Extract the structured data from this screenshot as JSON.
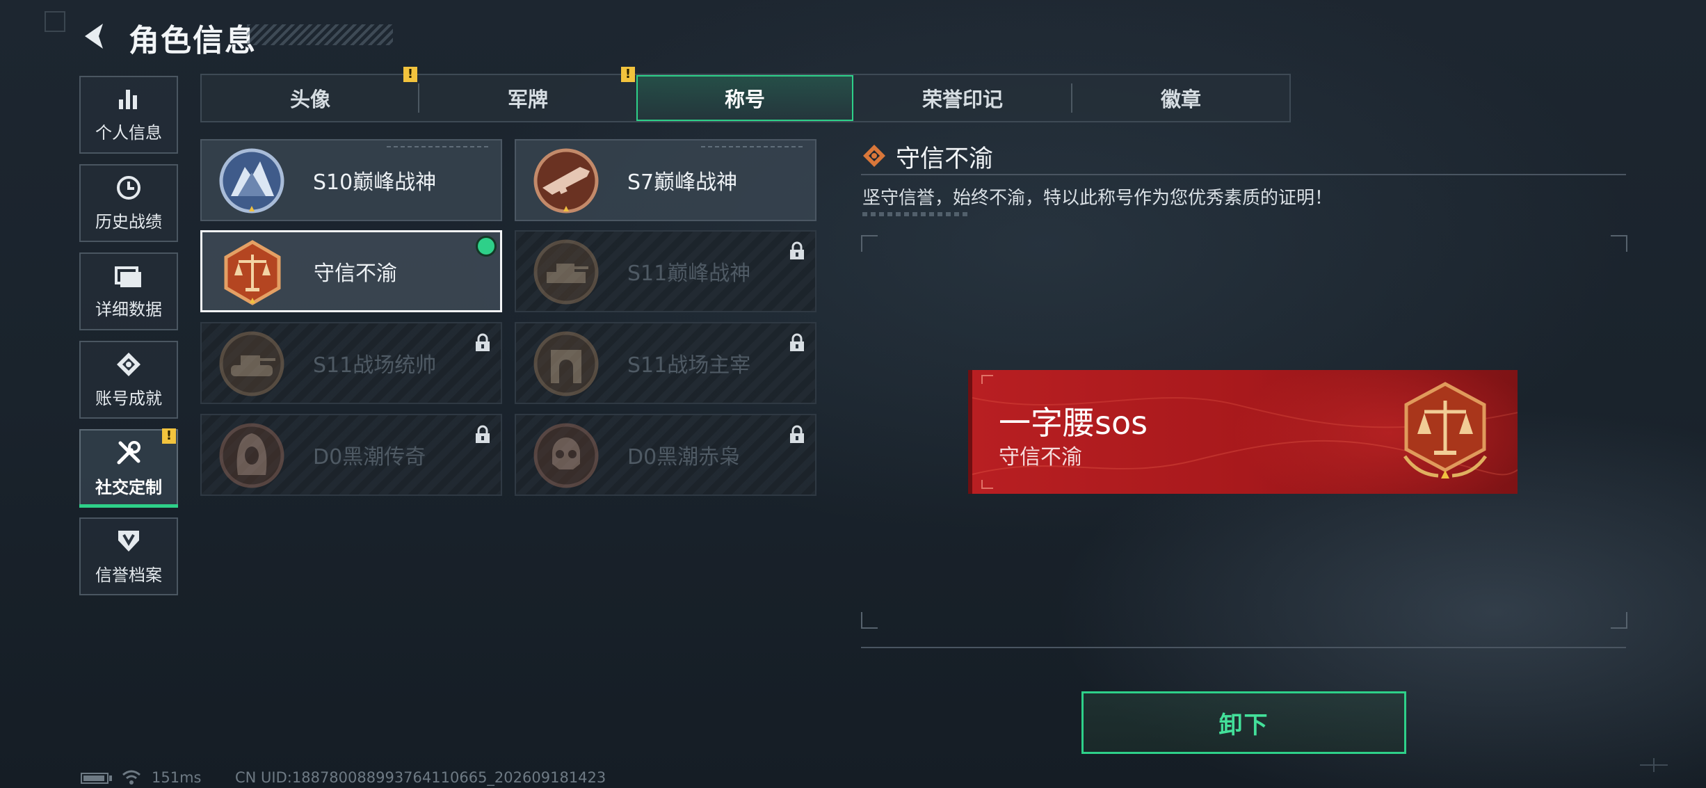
{
  "header": {
    "title": "角色信息"
  },
  "nav": [
    {
      "label": "个人信息",
      "icon": "bar-chart-icon"
    },
    {
      "label": "历史战绩",
      "icon": "clock-icon"
    },
    {
      "label": "详细数据",
      "icon": "folder-icon"
    },
    {
      "label": "账号成就",
      "icon": "achievement-icon"
    },
    {
      "label": "社交定制",
      "icon": "tools-icon",
      "active": true,
      "alert": "!"
    },
    {
      "label": "信誉档案",
      "icon": "credit-icon"
    }
  ],
  "tabs": [
    {
      "label": "头像",
      "alert": "!"
    },
    {
      "label": "军牌",
      "alert": "!"
    },
    {
      "label": "称号",
      "active": true
    },
    {
      "label": "荣誉印记"
    },
    {
      "label": "徽章"
    }
  ],
  "titles": [
    {
      "name": "S10巅峰战神",
      "state": "unlocked",
      "medal": "mountain-medal-icon"
    },
    {
      "name": "S7巅峰战神",
      "state": "unlocked",
      "medal": "weapon-medal-icon"
    },
    {
      "name": "守信不渝",
      "state": "equipped",
      "medal": "scales-medal-icon"
    },
    {
      "name": "S11巅峰战神",
      "state": "locked",
      "medal": "tank-medal-icon"
    },
    {
      "name": "S11战场统帅",
      "state": "locked",
      "medal": "tank-medal-icon"
    },
    {
      "name": "S11战场主宰",
      "state": "locked",
      "medal": "arch-medal-icon"
    },
    {
      "name": "D0黑潮传奇",
      "state": "locked",
      "medal": "hood-medal-icon"
    },
    {
      "name": "D0黑潮赤枭",
      "state": "locked",
      "medal": "skull-medal-icon"
    }
  ],
  "detail": {
    "title": "守信不渝",
    "description": "坚守信誉，始终不渝，特以此称号作为您优秀素质的证明！",
    "banner": {
      "player_name": "一字腰sos",
      "title": "守信不渝"
    },
    "unequip_label": "卸下"
  },
  "status": {
    "ping": "151ms",
    "uid": "CN UID:18878008899376411066​5_202609181423"
  },
  "colors": {
    "accent": "#2ed089",
    "alert": "#f2c33d",
    "banner": "#b81f22",
    "medal_bronze": "#b85b2a"
  }
}
